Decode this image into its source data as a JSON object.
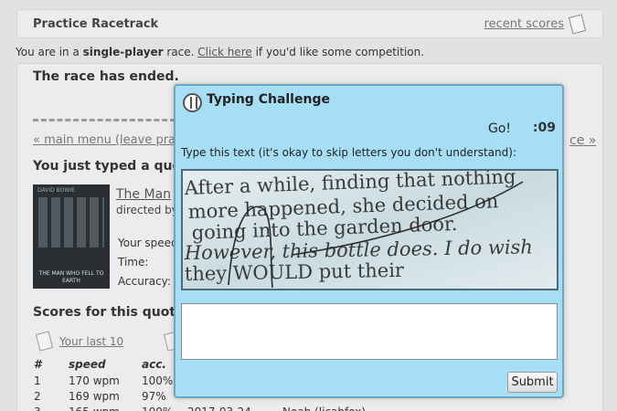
{
  "header": {
    "title": "Practice Racetrack",
    "recent_scores": "recent scores"
  },
  "notice": {
    "prefix": "You are in a ",
    "mode": "single-player",
    "middle": " race. ",
    "link": "Click here",
    "suffix": " if you'd like some competition."
  },
  "race": {
    "ended": "The race has ended.",
    "main_menu_link": "« main menu (leave practice)",
    "next_link": "ce »",
    "typed_heading": "You just typed a quote",
    "movie_title": "The Man",
    "directed_by": "directed by",
    "poster": {
      "top_text": "DAVID BOWIE",
      "bottom_text": "THE MAN WHO FELL TO EARTH"
    },
    "stats_labels": [
      "Your speed",
      "Time:",
      "Accuracy:"
    ]
  },
  "scores": {
    "heading": "Scores for this quote",
    "last10": "Your last 10",
    "columns": [
      "#",
      "speed",
      "acc."
    ],
    "rows": [
      {
        "rank": "1",
        "speed": "170 wpm",
        "acc": "100%",
        "date": "",
        "name": ""
      },
      {
        "rank": "2",
        "speed": "169 wpm",
        "acc": "97%",
        "date": "",
        "name": ""
      },
      {
        "rank": "3",
        "speed": "165 wpm",
        "acc": "100%",
        "date": "2017-03-24",
        "name": "Noah (licabfox)"
      }
    ]
  },
  "modal": {
    "title": "Typing Challenge",
    "go": "Go!",
    "timer": ":09",
    "instruction": "Type this text (it's okay to skip letters you don't understand):",
    "captcha_lines": [
      "After a while, finding that nothing",
      "more happened, she decided on",
      "going into the garden door.",
      "However, this bottle does. I do wish",
      "they WOULD put their"
    ],
    "submit": "Submit"
  },
  "colors": {
    "modal_bg": "#a6dff5",
    "modal_border": "#6ea7c0",
    "page_bg": "#e2e2e2"
  }
}
